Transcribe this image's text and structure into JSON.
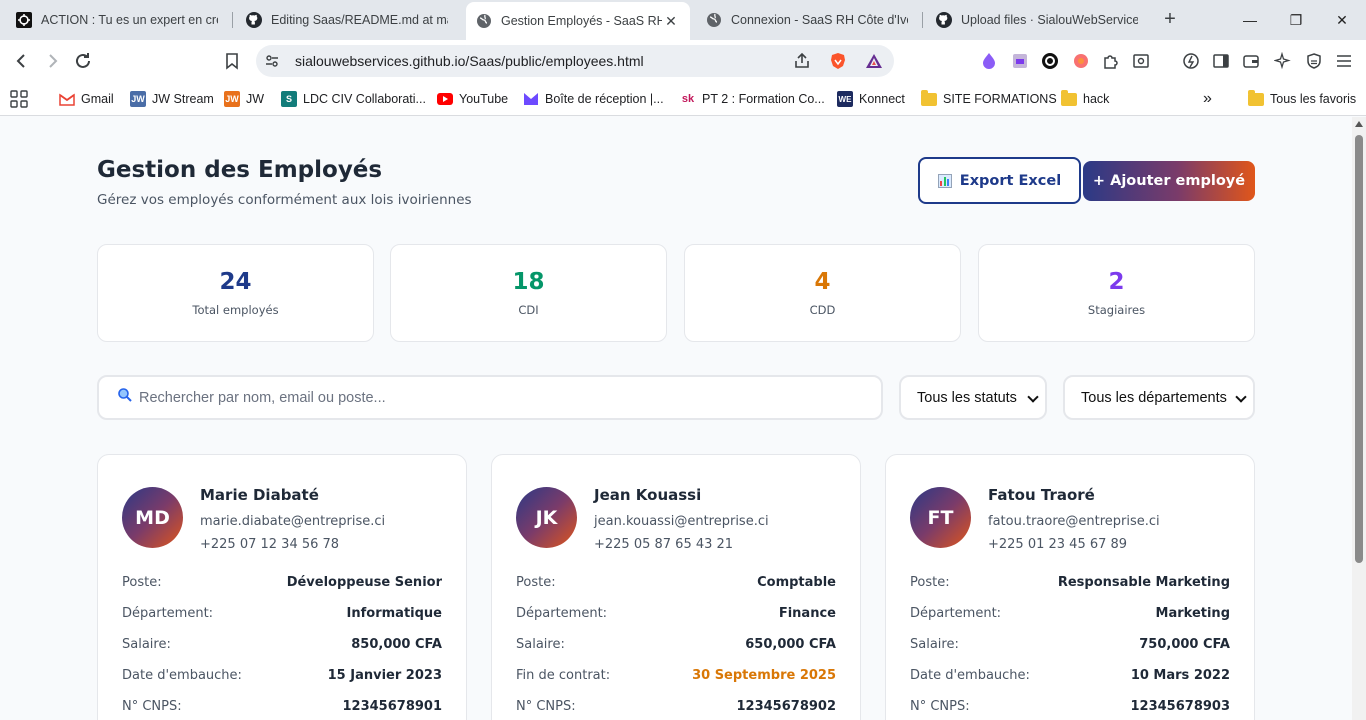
{
  "browser": {
    "tabs": [
      {
        "title": "ACTION : Tu es un expert en créa",
        "active": false,
        "icon": "puzzle-favicon"
      },
      {
        "title": "Editing Saas/README.md at mair",
        "active": false,
        "icon": "github-icon"
      },
      {
        "title": "Gestion Employés - SaaS RH",
        "active": true,
        "icon": "globe-icon"
      },
      {
        "title": "Connexion - SaaS RH Côte d'Ivoir",
        "active": false,
        "icon": "globe-icon"
      },
      {
        "title": "Upload files · SialouWebServices/",
        "active": false,
        "icon": "github-icon"
      }
    ],
    "url": "sialouwebservices.github.io/Saas/public/employees.html",
    "bookmarks": [
      {
        "label": "Gmail"
      },
      {
        "label": "JW Stream"
      },
      {
        "label": "JW"
      },
      {
        "label": "LDC CIV Collaborati..."
      },
      {
        "label": "YouTube"
      },
      {
        "label": "Boîte de réception |..."
      },
      {
        "label": "PT 2 : Formation Co..."
      },
      {
        "label": "Konnect"
      },
      {
        "label": "SITE FORMATIONS"
      },
      {
        "label": "hack"
      }
    ],
    "all_bookmarks_label": "Tous les favoris",
    "overflow_label": "»"
  },
  "header": {
    "title": "Gestion des Employés",
    "subtitle": "Gérez vos employés conformément aux lois ivoiriennes",
    "export_label": "Export Excel",
    "add_label": "+ Ajouter employé"
  },
  "stats": [
    {
      "value": "24",
      "label": "Total employés",
      "color": "#1e3a8a"
    },
    {
      "value": "18",
      "label": "CDI",
      "color": "#059669"
    },
    {
      "value": "4",
      "label": "CDD",
      "color": "#d97706"
    },
    {
      "value": "2",
      "label": "Stagiaires",
      "color": "#7c3aed"
    }
  ],
  "filters": {
    "search_placeholder": "Rechercher par nom, email ou poste...",
    "status_selected": "Tous les statuts",
    "department_selected": "Tous les départements"
  },
  "colors": {
    "primary": "#1e3a8a",
    "accent": "#e0561a",
    "warning": "#d97706"
  },
  "employees": [
    {
      "initials": "MD",
      "name": "Marie Diabaté",
      "email": "marie.diabate@entreprise.ci",
      "phone": "+225 07 12 34 56 78",
      "fields": [
        {
          "label": "Poste:",
          "value": "Développeuse Senior"
        },
        {
          "label": "Département:",
          "value": "Informatique"
        },
        {
          "label": "Salaire:",
          "value": "850,000 CFA"
        },
        {
          "label": "Date d'embauche:",
          "value": "15 Janvier 2023"
        },
        {
          "label": "N° CNPS:",
          "value": "12345678901"
        }
      ]
    },
    {
      "initials": "JK",
      "name": "Jean Kouassi",
      "email": "jean.kouassi@entreprise.ci",
      "phone": "+225 05 87 65 43 21",
      "fields": [
        {
          "label": "Poste:",
          "value": "Comptable"
        },
        {
          "label": "Département:",
          "value": "Finance"
        },
        {
          "label": "Salaire:",
          "value": "650,000 CFA"
        },
        {
          "label": "Fin de contrat:",
          "value": "30 Septembre 2025"
        },
        {
          "label": "N° CNPS:",
          "value": "12345678902"
        }
      ]
    },
    {
      "initials": "FT",
      "name": "Fatou Traoré",
      "email": "fatou.traore@entreprise.ci",
      "phone": "+225 01 23 45 67 89",
      "fields": [
        {
          "label": "Poste:",
          "value": "Responsable Marketing"
        },
        {
          "label": "Département:",
          "value": "Marketing"
        },
        {
          "label": "Salaire:",
          "value": "750,000 CFA"
        },
        {
          "label": "Date d'embauche:",
          "value": "10 Mars 2022"
        },
        {
          "label": "N° CNPS:",
          "value": "12345678903"
        }
      ]
    }
  ]
}
